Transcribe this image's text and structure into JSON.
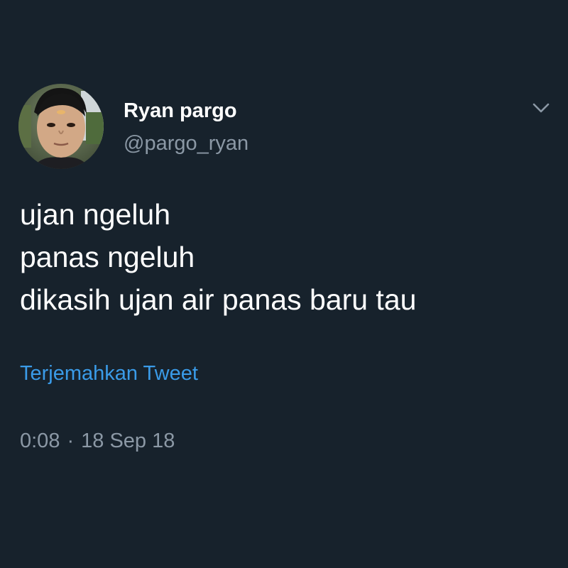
{
  "user": {
    "display_name": "Ryan pargo",
    "handle": "@pargo_ryan",
    "avatar_icon": "profile-photo"
  },
  "tweet": {
    "lines": [
      "ujan ngeluh",
      "panas ngeluh",
      "dikasih ujan air panas baru tau"
    ],
    "translate_label": "Terjemahkan Tweet",
    "time": "0:08",
    "separator": "·",
    "date": "18 Sep 18"
  },
  "menu": {
    "icon": "chevron-down-icon"
  },
  "colors": {
    "background": "#17222c",
    "text_primary": "#ffffff",
    "text_secondary": "#8b98a5",
    "link": "#3a9be8"
  }
}
